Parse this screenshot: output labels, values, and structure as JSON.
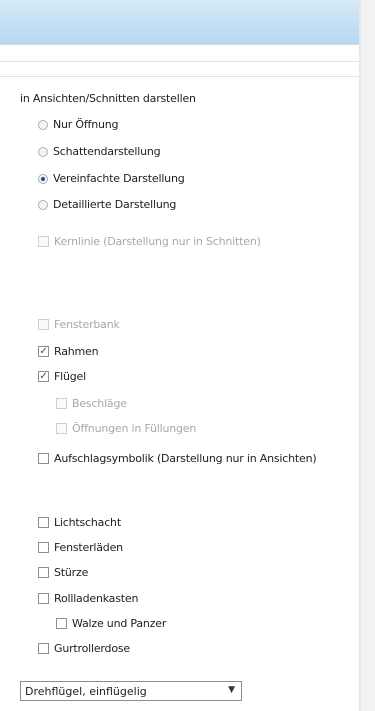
{
  "section_title": "in Ansichten/Schnitten darstellen",
  "radios": [
    {
      "label": "Nur Öffnung",
      "selected": false,
      "disabled": false
    },
    {
      "label": "Schattendarstellung",
      "selected": false,
      "disabled": false
    },
    {
      "label": "Vereinfachte Darstellung",
      "selected": true,
      "disabled": false
    },
    {
      "label": "Detaillierte Darstellung",
      "selected": false,
      "disabled": false
    }
  ],
  "checks": [
    {
      "label": "Kernlinie (Darstellung nur in Schnitten)",
      "checked": false,
      "disabled": true
    },
    {
      "label": "Fensterbank",
      "checked": false,
      "disabled": true
    },
    {
      "label": "Rahmen",
      "checked": true,
      "disabled": false
    },
    {
      "label": "Flügel",
      "checked": true,
      "disabled": false
    },
    {
      "label": "Beschläge",
      "checked": false,
      "disabled": true
    },
    {
      "label": "Öffnungen in Füllungen",
      "checked": false,
      "disabled": true
    },
    {
      "label": "Aufschlagsymbolik (Darstellung nur in Ansichten)",
      "checked": false,
      "disabled": false
    },
    {
      "label": "Lichtschacht",
      "checked": false,
      "disabled": false
    },
    {
      "label": "Fensterläden",
      "checked": false,
      "disabled": false
    },
    {
      "label": "Stürze",
      "checked": false,
      "disabled": false
    },
    {
      "label": "Rollladenkasten",
      "checked": false,
      "disabled": false
    },
    {
      "label": "Walze und Panzer",
      "checked": false,
      "disabled": false
    },
    {
      "label": "Gurtrollerdose",
      "checked": false,
      "disabled": false
    }
  ],
  "dropdown": {
    "value": "Drehflügel, einflügelig",
    "icon": "chevron-down-icon"
  }
}
